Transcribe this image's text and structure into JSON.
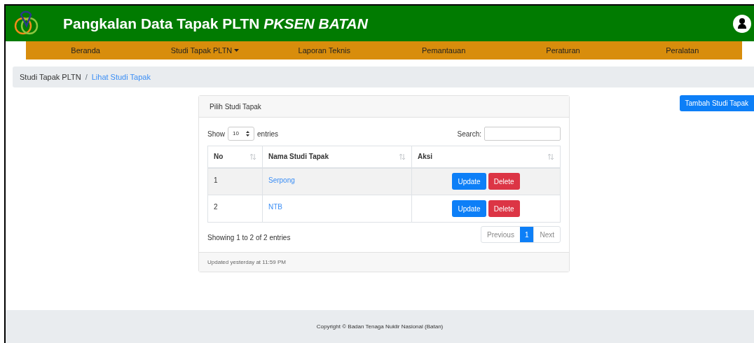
{
  "header": {
    "title": "Pangkalan Data Tapak PLTN",
    "title_emphasis": "PKSEN BATAN"
  },
  "nav": [
    {
      "label": "Beranda",
      "dropdown": false
    },
    {
      "label": "Studi Tapak PLTN",
      "dropdown": true
    },
    {
      "label": "Laporan Teknis",
      "dropdown": false
    },
    {
      "label": "Pemantauan",
      "dropdown": false
    },
    {
      "label": "Peraturan",
      "dropdown": false
    },
    {
      "label": "Peralatan",
      "dropdown": false
    }
  ],
  "breadcrumb_separator": "/",
  "breadcrumb": [
    {
      "label": "Studi Tapak PLTN",
      "current": false
    },
    {
      "label": "Lihat Studi Tapak",
      "current": true
    }
  ],
  "add_button": "Tambah Studi Tapak",
  "card": {
    "title": "Pilih Studi Tapak",
    "show_label": "Show",
    "page_size": "10",
    "entries_label": "entries",
    "search_label": "Search:",
    "table": {
      "columns": [
        "No",
        "Nama Studi Tapak",
        "Aksi"
      ],
      "rows": [
        {
          "no": "1",
          "name": "Serpong",
          "actions": [
            "Update",
            "Delete"
          ]
        },
        {
          "no": "2",
          "name": "NTB",
          "actions": [
            "Update",
            "Delete"
          ]
        }
      ]
    },
    "info": "Showing 1 to 2 of 2 entries",
    "pagination": {
      "previous": {
        "label": "Previous",
        "disabled": true
      },
      "pages": [
        {
          "label": "1",
          "selected": true
        }
      ],
      "next": {
        "label": "Next",
        "disabled": true
      }
    },
    "footer": "Updated yesterday at 11:59 PM"
  },
  "footer": "Copyright © Badan Tenaga Nuklir Nasional (Batan)"
}
